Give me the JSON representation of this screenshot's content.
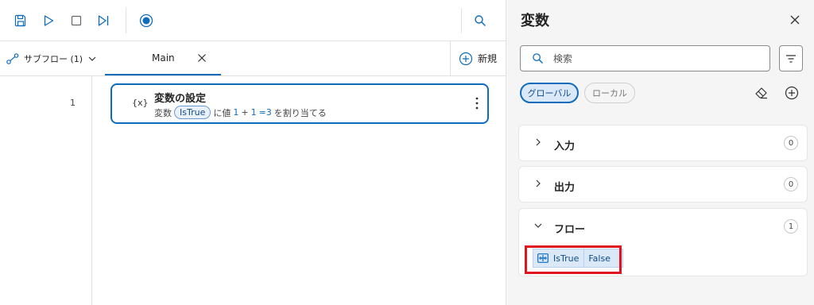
{
  "toolbar": {
    "icons": [
      "save-icon",
      "run-icon",
      "stop-icon",
      "run-next-action-icon",
      "record-icon",
      "search-icon"
    ]
  },
  "tabs": {
    "subflows_label": "サブフロー (1)",
    "main_tab_label": "Main",
    "new_label": "新規"
  },
  "editor": {
    "line_number": "1",
    "action": {
      "icon": "{x}",
      "title": "変数の設定",
      "desc_prefix": "変数",
      "variable": "IsTrue",
      "desc_mid": "に値",
      "value_a": "1",
      "plus": "+",
      "value_b": "1",
      "equals": "=3",
      "desc_suffix": "を割り当てる"
    }
  },
  "variables_pane": {
    "title": "変数",
    "search_placeholder": "検索",
    "scopes": {
      "global": "グローバル",
      "local": "ローカル"
    },
    "sections": [
      {
        "label": "入力",
        "count": "0",
        "expanded": false
      },
      {
        "label": "出力",
        "count": "0",
        "expanded": false
      },
      {
        "label": "フロー",
        "count": "1",
        "expanded": true
      }
    ],
    "flow_variables": [
      {
        "name": "IsTrue",
        "value": "False"
      }
    ]
  },
  "colors": {
    "accent": "#0f6cbd",
    "highlight": "#e0141e",
    "pane_background": "#f5f5f5"
  }
}
